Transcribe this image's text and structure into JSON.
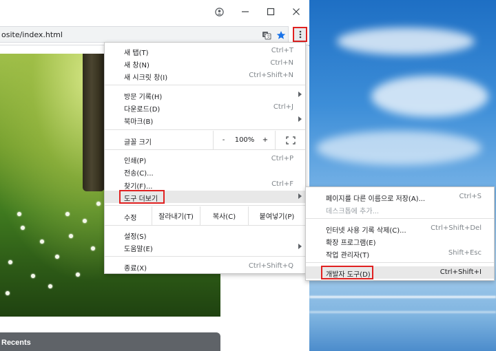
{
  "browser": {
    "url": "osite/index.html",
    "page_section_label": "Recents"
  },
  "menu": {
    "new_tab": {
      "label": "새 탭(T)",
      "shortcut": "Ctrl+T"
    },
    "new_window": {
      "label": "새 창(N)",
      "shortcut": "Ctrl+N"
    },
    "new_incognito": {
      "label": "새 시크릿 창(I)",
      "shortcut": "Ctrl+Shift+N"
    },
    "history": {
      "label": "방문 기록(H)"
    },
    "downloads": {
      "label": "다운로드(D)",
      "shortcut": "Ctrl+J"
    },
    "bookmarks": {
      "label": "북마크(B)"
    },
    "zoom": {
      "label": "글꼴 크기",
      "minus": "-",
      "value": "100%",
      "plus": "+"
    },
    "print": {
      "label": "인쇄(P)",
      "shortcut": "Ctrl+P"
    },
    "cast": {
      "label": "전송(C)..."
    },
    "find": {
      "label": "찾기(F)...",
      "shortcut": "Ctrl+F"
    },
    "more_tools": {
      "label": "도구 더보기"
    },
    "edit": {
      "label": "수정",
      "cut": "잘라내기(T)",
      "copy": "복사(C)",
      "paste": "붙여넣기(P)"
    },
    "settings": {
      "label": "설정(S)"
    },
    "help": {
      "label": "도움말(E)"
    },
    "exit": {
      "label": "종료(X)",
      "shortcut": "Ctrl+Shift+Q"
    }
  },
  "submenu": {
    "save_page": {
      "label": "페이지를 다른 이름으로 저장(A)...",
      "shortcut": "Ctrl+S"
    },
    "add_to_desktop": {
      "label": "데스크톱에 추가..."
    },
    "clear_data": {
      "label": "인터넷 사용 기록 삭제(C)...",
      "shortcut": "Ctrl+Shift+Del"
    },
    "extensions": {
      "label": "확장 프로그램(E)"
    },
    "task_manager": {
      "label": "작업 관리자(T)",
      "shortcut": "Shift+Esc"
    },
    "dev_tools": {
      "label": "개발자 도구(D)",
      "shortcut": "Ctrl+Shift+I"
    }
  },
  "icons": {
    "account": "account-circle-icon",
    "minimize": "minimize-icon",
    "maximize": "maximize-icon",
    "close": "close-icon",
    "translate": "translate-icon",
    "bookmark": "star-icon",
    "menu": "kebab-menu-icon",
    "fullscreen": "fullscreen-icon"
  },
  "colors": {
    "highlight_border": "#e02020",
    "bookmark_star": "#1a73e8",
    "menu_hover": "#e8e8e8"
  }
}
